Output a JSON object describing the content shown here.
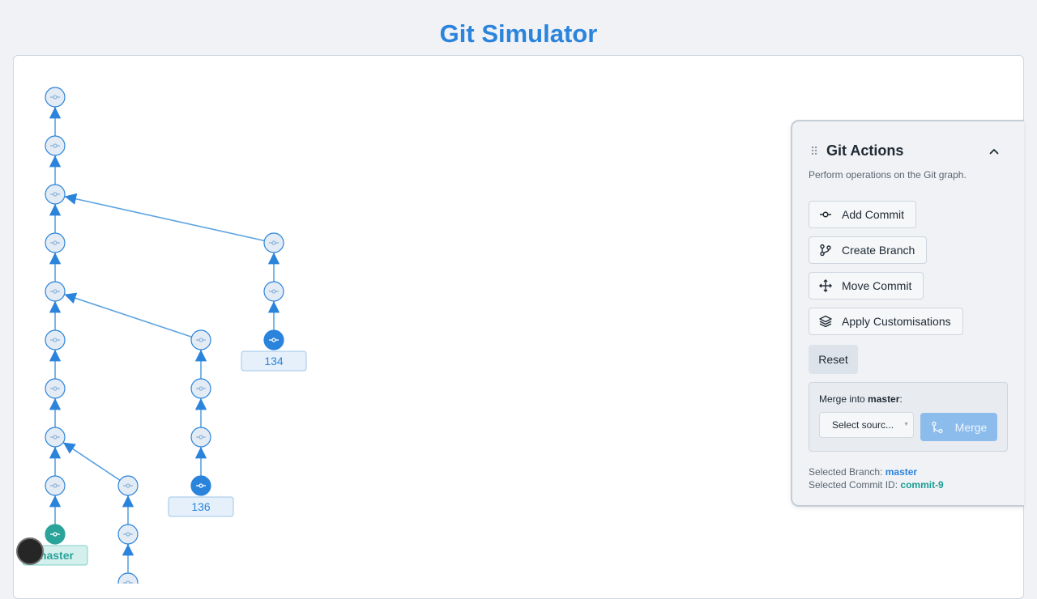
{
  "app": {
    "title": "Git Simulator"
  },
  "graph": {
    "branch_labels": [
      {
        "name": "134",
        "kind": "branch"
      },
      {
        "name": "136",
        "kind": "branch"
      },
      {
        "name": "master",
        "kind": "current"
      }
    ]
  },
  "panel": {
    "title": "Git Actions",
    "description": "Perform operations on the Git graph.",
    "actions": [
      {
        "label": "Add Commit",
        "icon": "commit-icon"
      },
      {
        "label": "Create Branch",
        "icon": "git-branch-icon"
      },
      {
        "label": "Move Commit",
        "icon": "move-icon"
      },
      {
        "label": "Apply Customisations",
        "icon": "layers-icon"
      }
    ],
    "reset_label": "Reset",
    "merge": {
      "label_prefix": "Merge into",
      "target": "master",
      "label_suffix": ":",
      "select_placeholder": "Select sourc...",
      "button_label": "Merge"
    },
    "selected_branch_label": "Selected Branch:",
    "selected_branch": "master",
    "selected_commit_label": "Selected Commit ID:",
    "selected_commit": "commit-9"
  },
  "colors": {
    "accent": "#2b84dc",
    "current_branch": "#2aa39b",
    "node_fill": "#e3ebf4",
    "edge": "#5ba3e0"
  }
}
